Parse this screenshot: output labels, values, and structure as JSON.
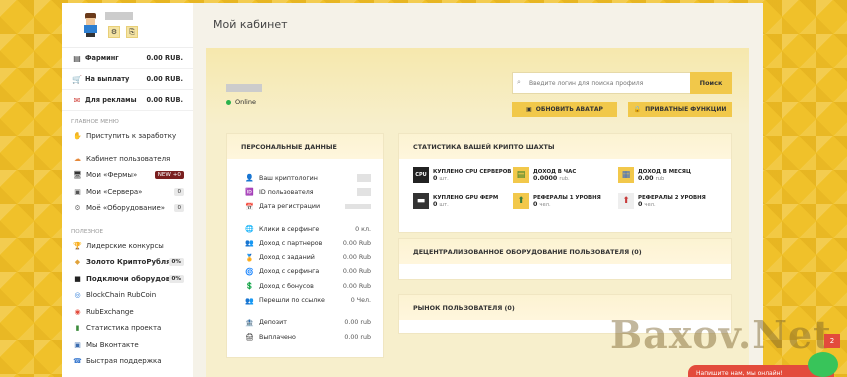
{
  "page": {
    "title": "Мой кабинет"
  },
  "profile": {
    "online": "Online"
  },
  "balances": [
    {
      "icon": "wallet-icon",
      "label": "Фарминг",
      "value": "0.00 RUB."
    },
    {
      "icon": "cart-icon",
      "label": "На выплату",
      "value": "0.00 RUB."
    },
    {
      "icon": "megaphone-icon",
      "label": "Для рекламы",
      "value": "0.00 RUB."
    }
  ],
  "menu": {
    "main_title": "Главное меню",
    "main_items": [
      {
        "label": "Приступить к заработку",
        "badge": ""
      },
      {
        "label": "Кабинет пользователя",
        "badge": ""
      },
      {
        "label": "Мои «Фермы»",
        "badge": "NEW +0"
      },
      {
        "label": "Мои «Сервера»",
        "badge": "0"
      },
      {
        "label": "Моё «Оборудование»",
        "badge": "0"
      }
    ],
    "useful_title": "Полезное",
    "useful_items": [
      {
        "label": "Лидерские конкурсы",
        "badge": ""
      },
      {
        "label": "Золото КриптоРубля",
        "badge": "0%"
      },
      {
        "label": "Подключи оборудован...",
        "badge": "0%"
      },
      {
        "label": "BlockChain RubCoin",
        "badge": ""
      },
      {
        "label": "RubExchange",
        "badge": ""
      },
      {
        "label": "Статистика проекта",
        "badge": ""
      },
      {
        "label": "Мы Вконтакте",
        "badge": ""
      },
      {
        "label": "Быстрая поддержка",
        "badge": ""
      }
    ]
  },
  "search": {
    "placeholder": "Введите логин для поиска профиля",
    "button": "Поиск"
  },
  "actions": {
    "avatar": "Обновить аватар",
    "private": "Приватные функции"
  },
  "personal": {
    "title": "Персональные данные",
    "group1": [
      {
        "label": "Ваш криптологин",
        "value": ""
      },
      {
        "label": "ID пользователя",
        "value": ""
      },
      {
        "label": "Дата регистрации",
        "value": ""
      }
    ],
    "group2": [
      {
        "label": "Клики в серфинге",
        "value": "0 кл."
      },
      {
        "label": "Доход с партнеров",
        "value": "0.00 Rub"
      },
      {
        "label": "Доход с заданий",
        "value": "0.00 Rub"
      },
      {
        "label": "Доход с серфинга",
        "value": "0.00 Rub"
      },
      {
        "label": "Доход с бонусов",
        "value": "0.00 Rub"
      },
      {
        "label": "Перешли по ссылке",
        "value": "0 Чел."
      }
    ],
    "group3": [
      {
        "label": "Депозит",
        "value": "0.00 rub"
      },
      {
        "label": "Выплачено",
        "value": "0.00 rub"
      }
    ]
  },
  "stats": {
    "title": "Статистика вашей крипто шахты",
    "items": [
      {
        "icon": "cpu-icon",
        "title": "Куплено CPU серверов",
        "value": "0",
        "unit": "шт."
      },
      {
        "icon": "income-hour-icon",
        "title": "Доход в час",
        "value": "0.0000",
        "unit": "rub."
      },
      {
        "icon": "income-month-icon",
        "title": "Доход в месяц",
        "value": "0.00",
        "unit": "rub"
      },
      {
        "icon": "gpu-icon",
        "title": "Куплено GPU ферм",
        "value": "0",
        "unit": "шт."
      },
      {
        "icon": "referral-icon",
        "title": "Рефералы 1 уровня",
        "value": "0",
        "unit": "чел."
      },
      {
        "icon": "referral2-icon",
        "title": "Рефералы 2 уровня",
        "value": "0",
        "unit": "чел."
      }
    ]
  },
  "decentral": {
    "title": "Децентрализованное оборудование пользователя (0)"
  },
  "market": {
    "title": "Рынок пользователя (0)"
  },
  "chat": {
    "text": "Напишите нам, мы онлайн!",
    "count": "2"
  },
  "watermark": {
    "text": "Baxov.Net"
  }
}
